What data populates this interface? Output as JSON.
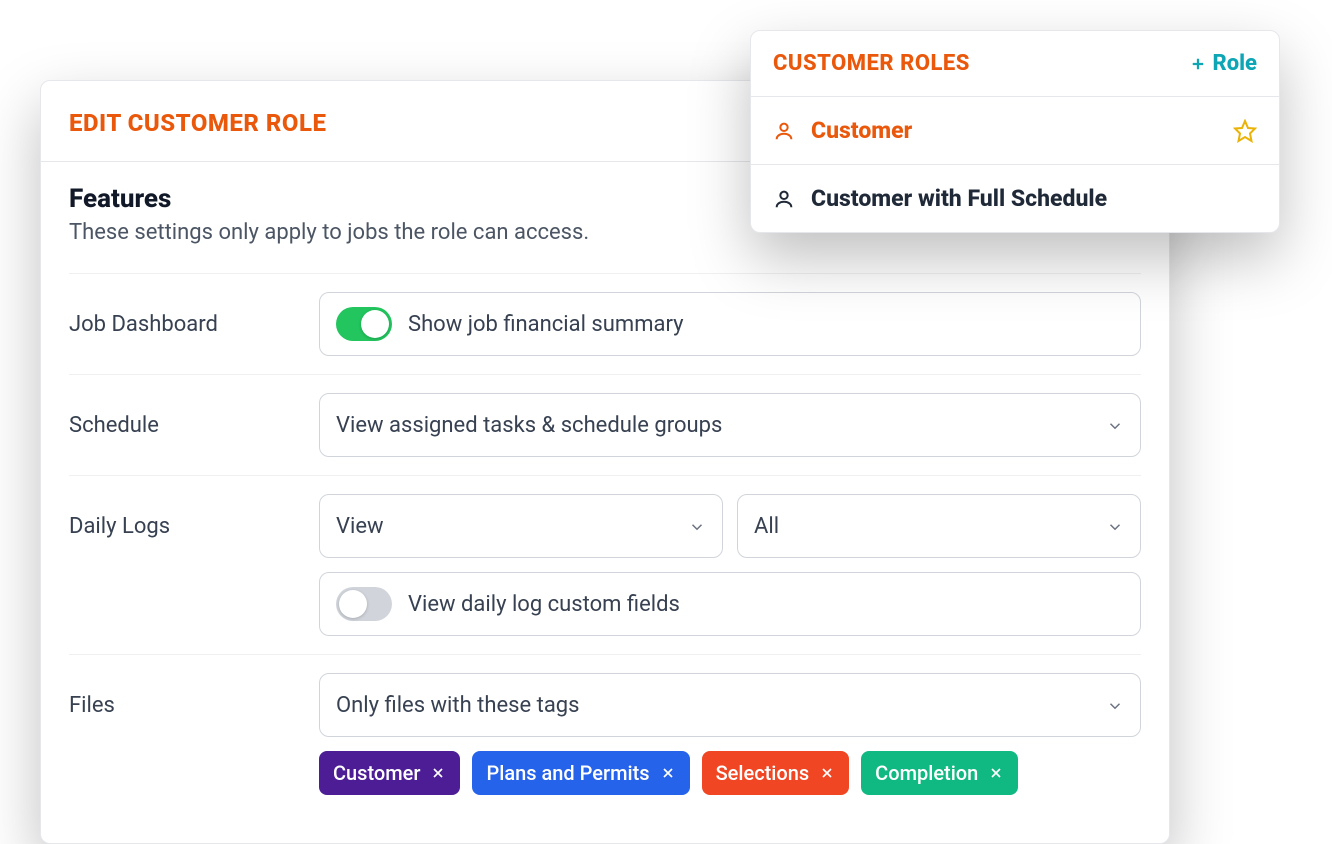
{
  "panel": {
    "title": "EDIT CUSTOMER ROLE",
    "features_heading": "Features",
    "features_desc": "These settings only apply to jobs the role can access.",
    "rows": {
      "job_dashboard": {
        "label": "Job Dashboard",
        "toggle": {
          "on": true,
          "label": "Show job financial summary"
        }
      },
      "schedule": {
        "label": "Schedule",
        "select_value": "View assigned tasks & schedule groups"
      },
      "daily_logs": {
        "label": "Daily Logs",
        "view_select": "View",
        "scope_select": "All",
        "custom_fields_toggle": {
          "on": false,
          "label": "View daily log custom fields"
        }
      },
      "files": {
        "label": "Files",
        "select_value": "Only files with these tags",
        "tags": [
          {
            "label": "Customer",
            "color": "#4c1d95"
          },
          {
            "label": "Plans and Permits",
            "color": "#2563eb"
          },
          {
            "label": "Selections",
            "color": "#f04623"
          },
          {
            "label": "Completion",
            "color": "#10b981"
          }
        ]
      }
    }
  },
  "popover": {
    "title": "CUSTOMER ROLES",
    "add_label": "Role",
    "items": [
      {
        "label": "Customer",
        "selected": true,
        "starred": true
      },
      {
        "label": "Customer with Full Schedule",
        "selected": false,
        "starred": false
      }
    ]
  }
}
